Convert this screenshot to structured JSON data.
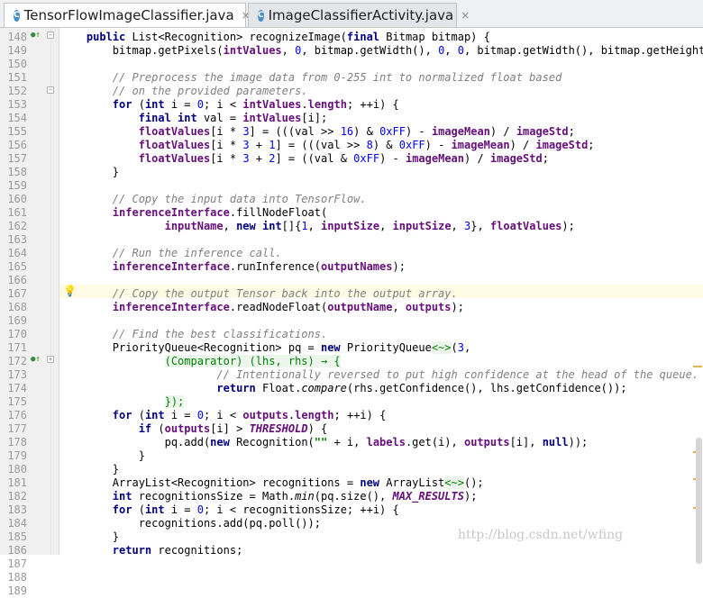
{
  "tabs": [
    {
      "label": "TensorFlowImageClassifier.java",
      "icon": "class-icon",
      "active": true
    },
    {
      "label": "ImageClassifierActivity.java",
      "icon": "class-icon",
      "active": false
    }
  ],
  "tab_icon_letter": "C",
  "close_glyph": "×",
  "watermark": "http://blog.csdn.net/wfing",
  "line_numbers": [
    "148",
    "149",
    "150",
    "151",
    "152",
    "153",
    "154",
    "155",
    "156",
    "157",
    "158",
    "159",
    "160",
    "161",
    "162",
    "163",
    "164",
    "165",
    "166",
    "167",
    "168",
    "169",
    "170",
    "171",
    "172",
    "173",
    "174",
    "175",
    "176",
    "177",
    "178",
    "179",
    "180",
    "181",
    "182",
    "183",
    "184",
    "185",
    "186",
    "187",
    "188",
    "189"
  ],
  "code": [
    [
      [
        "    ",
        ""
      ],
      [
        "public ",
        "kw"
      ],
      [
        "List<Recognition> recognizeImage(",
        ""
      ],
      [
        "final ",
        "kw"
      ],
      [
        "Bitmap bitmap) {",
        ""
      ]
    ],
    [
      [
        "        bitmap.getPixels(",
        ""
      ],
      [
        "intValues",
        "fld"
      ],
      [
        ", ",
        ""
      ],
      [
        "0",
        "num"
      ],
      [
        ", bitmap.getWidth(), ",
        ""
      ],
      [
        "0",
        "num"
      ],
      [
        ", ",
        ""
      ],
      [
        "0",
        "num"
      ],
      [
        ", bitmap.getWidth(), bitmap.getHeight());",
        ""
      ]
    ],
    [
      [
        "",
        ""
      ]
    ],
    [
      [
        "        ",
        ""
      ],
      [
        "// Preprocess the image data from 0-255 int to normalized float based",
        "cmt"
      ]
    ],
    [
      [
        "        ",
        ""
      ],
      [
        "// on the provided parameters.",
        "cmt"
      ]
    ],
    [
      [
        "        ",
        ""
      ],
      [
        "for ",
        "kw"
      ],
      [
        "(",
        ""
      ],
      [
        "int ",
        "kw"
      ],
      [
        "i = ",
        ""
      ],
      [
        "0",
        "num"
      ],
      [
        "; i < ",
        ""
      ],
      [
        "intValues",
        "fld"
      ],
      [
        ".",
        ""
      ],
      [
        "length",
        "fld"
      ],
      [
        "; ++i) {",
        ""
      ]
    ],
    [
      [
        "            ",
        ""
      ],
      [
        "final int ",
        "kw"
      ],
      [
        "val = ",
        ""
      ],
      [
        "intValues",
        "fld"
      ],
      [
        "[i];",
        ""
      ]
    ],
    [
      [
        "            ",
        ""
      ],
      [
        "floatValues",
        "fld"
      ],
      [
        "[i * ",
        ""
      ],
      [
        "3",
        "num"
      ],
      [
        "] = (((val >> ",
        ""
      ],
      [
        "16",
        "num"
      ],
      [
        ") & ",
        ""
      ],
      [
        "0xFF",
        "num"
      ],
      [
        ") - ",
        ""
      ],
      [
        "imageMean",
        "fld"
      ],
      [
        ") / ",
        ""
      ],
      [
        "imageStd",
        "fld"
      ],
      [
        ";",
        ""
      ]
    ],
    [
      [
        "            ",
        ""
      ],
      [
        "floatValues",
        "fld"
      ],
      [
        "[i * ",
        ""
      ],
      [
        "3 ",
        "num"
      ],
      [
        "+ ",
        ""
      ],
      [
        "1",
        "num"
      ],
      [
        "] = (((val >> ",
        ""
      ],
      [
        "8",
        "num"
      ],
      [
        ") & ",
        ""
      ],
      [
        "0xFF",
        "num"
      ],
      [
        ") - ",
        ""
      ],
      [
        "imageMean",
        "fld"
      ],
      [
        ") / ",
        ""
      ],
      [
        "imageStd",
        "fld"
      ],
      [
        ";",
        ""
      ]
    ],
    [
      [
        "            ",
        ""
      ],
      [
        "floatValues",
        "fld"
      ],
      [
        "[i * ",
        ""
      ],
      [
        "3 ",
        "num"
      ],
      [
        "+ ",
        ""
      ],
      [
        "2",
        "num"
      ],
      [
        "] = ((val & ",
        ""
      ],
      [
        "0xFF",
        "num"
      ],
      [
        ") - ",
        ""
      ],
      [
        "imageMean",
        "fld"
      ],
      [
        ") / ",
        ""
      ],
      [
        "imageStd",
        "fld"
      ],
      [
        ";",
        ""
      ]
    ],
    [
      [
        "        }",
        ""
      ]
    ],
    [
      [
        "",
        ""
      ]
    ],
    [
      [
        "        ",
        ""
      ],
      [
        "// Copy the input data into TensorFlow.",
        "cmt"
      ]
    ],
    [
      [
        "        ",
        ""
      ],
      [
        "inferenceInterface",
        "fld"
      ],
      [
        ".fillNodeFloat(",
        ""
      ]
    ],
    [
      [
        "                ",
        ""
      ],
      [
        "inputName",
        "fld"
      ],
      [
        ", ",
        ""
      ],
      [
        "new int",
        "kw"
      ],
      [
        "[]{",
        ""
      ],
      [
        "1",
        "num"
      ],
      [
        ", ",
        ""
      ],
      [
        "inputSize",
        "fld"
      ],
      [
        ", ",
        ""
      ],
      [
        "inputSize",
        "fld"
      ],
      [
        ", ",
        ""
      ],
      [
        "3",
        "num"
      ],
      [
        "}, ",
        ""
      ],
      [
        "floatValues",
        "fld"
      ],
      [
        ");",
        ""
      ]
    ],
    [
      [
        "",
        ""
      ]
    ],
    [
      [
        "        ",
        ""
      ],
      [
        "// Run the inference call.",
        "cmt"
      ]
    ],
    [
      [
        "        ",
        ""
      ],
      [
        "inferenceInterface",
        "fld"
      ],
      [
        ".runInference(",
        ""
      ],
      [
        "outputNames",
        "fld"
      ],
      [
        ");",
        ""
      ]
    ],
    [
      [
        "",
        ""
      ]
    ],
    [
      [
        "        ",
        ""
      ],
      [
        "// Copy the output Tensor back into the output array.",
        "cmt"
      ]
    ],
    [
      [
        "        ",
        ""
      ],
      [
        "inferenceInterface",
        "fld"
      ],
      [
        ".readNodeFloat(",
        ""
      ],
      [
        "outputName",
        "fld"
      ],
      [
        ", ",
        ""
      ],
      [
        "outputs",
        "fld"
      ],
      [
        ");",
        ""
      ]
    ],
    [
      [
        "",
        ""
      ]
    ],
    [
      [
        "        ",
        ""
      ],
      [
        "// Find the best classifications.",
        "cmt"
      ]
    ],
    [
      [
        "        PriorityQueue<Recognition> pq = ",
        ""
      ],
      [
        "new ",
        "kw"
      ],
      [
        "PriorityQueue",
        ""
      ],
      [
        "<~>",
        "fold-hint"
      ],
      [
        "(",
        ""
      ],
      [
        "3",
        "num"
      ],
      [
        ",",
        ""
      ]
    ],
    [
      [
        "                ",
        ""
      ],
      [
        "(Comparator) (lhs, rhs) → {",
        "fold-hint"
      ]
    ],
    [
      [
        "                        ",
        ""
      ],
      [
        "// Intentionally reversed to put high confidence at the head of the queue.",
        "cmt"
      ]
    ],
    [
      [
        "                        ",
        ""
      ],
      [
        "return ",
        "kw"
      ],
      [
        "Float.",
        ""
      ],
      [
        "compare",
        "stat"
      ],
      [
        "(rhs.getConfidence(), lhs.getConfidence());",
        ""
      ]
    ],
    [
      [
        "                ",
        ""
      ],
      [
        "});",
        "fold-hint"
      ]
    ],
    [
      [
        "        ",
        ""
      ],
      [
        "for ",
        "kw"
      ],
      [
        "(",
        ""
      ],
      [
        "int ",
        "kw"
      ],
      [
        "i = ",
        ""
      ],
      [
        "0",
        "num"
      ],
      [
        "; i < ",
        ""
      ],
      [
        "outputs",
        "fld"
      ],
      [
        ".",
        ""
      ],
      [
        "length",
        "fld"
      ],
      [
        "; ++i) {",
        ""
      ]
    ],
    [
      [
        "            ",
        ""
      ],
      [
        "if ",
        "kw"
      ],
      [
        "(",
        ""
      ],
      [
        "outputs",
        "fld"
      ],
      [
        "[i] > ",
        ""
      ],
      [
        "THRESHOLD",
        "const"
      ],
      [
        ") {",
        ""
      ]
    ],
    [
      [
        "                pq.add(",
        ""
      ],
      [
        "new ",
        "kw"
      ],
      [
        "Recognition(",
        ""
      ],
      [
        "\"\"",
        "str"
      ],
      [
        " + i, ",
        ""
      ],
      [
        "labels",
        "fld"
      ],
      [
        ".get(i), ",
        ""
      ],
      [
        "outputs",
        "fld"
      ],
      [
        "[i], ",
        ""
      ],
      [
        "null",
        "kw"
      ],
      [
        "));",
        ""
      ]
    ],
    [
      [
        "            }",
        ""
      ]
    ],
    [
      [
        "        }",
        ""
      ]
    ],
    [
      [
        "        ArrayList<Recognition> recognitions = ",
        ""
      ],
      [
        "new ",
        "kw"
      ],
      [
        "ArrayList",
        ""
      ],
      [
        "<~>",
        "fold-hint"
      ],
      [
        "();",
        ""
      ]
    ],
    [
      [
        "        ",
        ""
      ],
      [
        "int ",
        "kw"
      ],
      [
        "recognitionsSize = Math.",
        ""
      ],
      [
        "min",
        "stat"
      ],
      [
        "(pq.size(), ",
        ""
      ],
      [
        "MAX_RESULTS",
        "const"
      ],
      [
        ");",
        ""
      ]
    ],
    [
      [
        "        ",
        ""
      ],
      [
        "for ",
        "kw"
      ],
      [
        "(",
        ""
      ],
      [
        "int ",
        "kw"
      ],
      [
        "i = ",
        ""
      ],
      [
        "0",
        "num"
      ],
      [
        "; i < recognitionsSize; ++i) {",
        ""
      ]
    ],
    [
      [
        "            recognitions.add(pq.poll());",
        ""
      ]
    ],
    [
      [
        "        }",
        ""
      ]
    ],
    [
      [
        "        ",
        ""
      ],
      [
        "return ",
        "kw"
      ],
      [
        "recognitions;",
        ""
      ]
    ]
  ]
}
